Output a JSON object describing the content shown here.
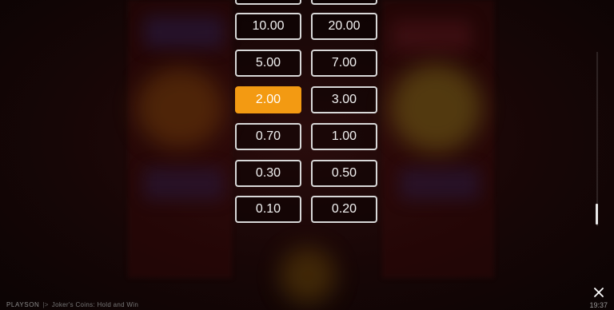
{
  "bet_options": {
    "row_partial": [
      "",
      ""
    ],
    "rows": [
      [
        "10.00",
        "20.00"
      ],
      [
        "5.00",
        "7.00"
      ],
      [
        "2.00",
        "3.00"
      ],
      [
        "0.70",
        "1.00"
      ],
      [
        "0.30",
        "0.50"
      ],
      [
        "0.10",
        "0.20"
      ]
    ],
    "selected": "2.00",
    "selected_color": "#f39a12"
  },
  "footer": {
    "provider": "PLAYSON",
    "provider_suffix": "|>",
    "game_title": "Joker's Coins: Hold and Win",
    "time": "19:37"
  },
  "controls": {
    "close_icon": "close-icon"
  }
}
